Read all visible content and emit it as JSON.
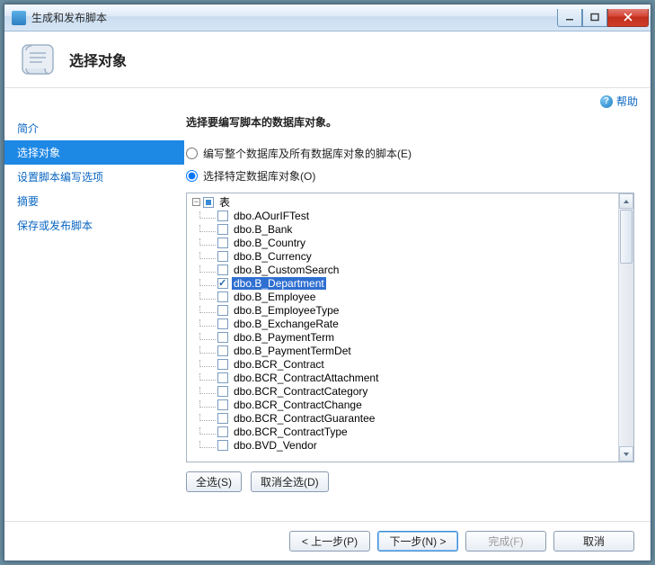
{
  "titlebar": {
    "title": "生成和发布脚本"
  },
  "header": {
    "title": "选择对象"
  },
  "sidebar": {
    "items": [
      {
        "label": "简介"
      },
      {
        "label": "选择对象"
      },
      {
        "label": "设置脚本编写选项"
      },
      {
        "label": "摘要"
      },
      {
        "label": "保存或发布脚本"
      }
    ],
    "selected_index": 1
  },
  "help": {
    "label": "帮助"
  },
  "main": {
    "prompt": "选择要编写脚本的数据库对象。",
    "radio_all": "编写整个数据库及所有数据库对象的脚本(E)",
    "radio_specific": "选择特定数据库对象(O)",
    "radio_selected": "specific"
  },
  "tree": {
    "root": {
      "label": "表",
      "checked": "mixed",
      "expanded": true
    },
    "items": [
      {
        "label": "dbo.AOurIFTest",
        "checked": false
      },
      {
        "label": "dbo.B_Bank",
        "checked": false
      },
      {
        "label": "dbo.B_Country",
        "checked": false
      },
      {
        "label": "dbo.B_Currency",
        "checked": false
      },
      {
        "label": "dbo.B_CustomSearch",
        "checked": false
      },
      {
        "label": "dbo.B_Department",
        "checked": true,
        "selected": true
      },
      {
        "label": "dbo.B_Employee",
        "checked": false
      },
      {
        "label": "dbo.B_EmployeeType",
        "checked": false
      },
      {
        "label": "dbo.B_ExchangeRate",
        "checked": false
      },
      {
        "label": "dbo.B_PaymentTerm",
        "checked": false
      },
      {
        "label": "dbo.B_PaymentTermDet",
        "checked": false
      },
      {
        "label": "dbo.BCR_Contract",
        "checked": false
      },
      {
        "label": "dbo.BCR_ContractAttachment",
        "checked": false
      },
      {
        "label": "dbo.BCR_ContractCategory",
        "checked": false
      },
      {
        "label": "dbo.BCR_ContractChange",
        "checked": false
      },
      {
        "label": "dbo.BCR_ContractGuarantee",
        "checked": false
      },
      {
        "label": "dbo.BCR_ContractType",
        "checked": false
      },
      {
        "label": "dbo.BVD_Vendor",
        "checked": false
      }
    ]
  },
  "buttons": {
    "select_all": "全选(S)",
    "deselect_all": "取消全选(D)",
    "prev": "< 上一步(P)",
    "next": "下一步(N) >",
    "finish": "完成(F)",
    "cancel": "取消"
  }
}
